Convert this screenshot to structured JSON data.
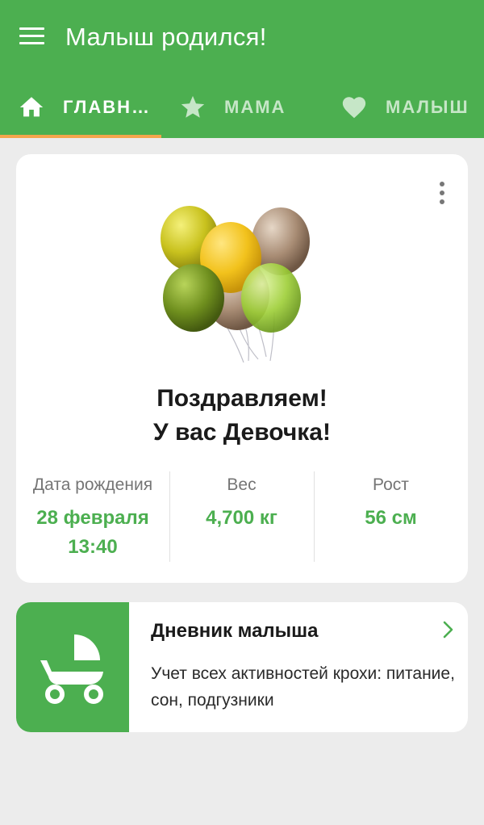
{
  "appbar": {
    "title": "Малыш родился!",
    "menu_icon": "hamburger-menu-icon",
    "color": "#4caf50"
  },
  "tabs": [
    {
      "label": "ГЛАВНАЯ",
      "icon": "home-icon",
      "active": true
    },
    {
      "label": "МАМА",
      "icon": "star-icon",
      "active": false
    },
    {
      "label": "МАЛЫШ",
      "icon": "heart-icon",
      "active": false
    }
  ],
  "tab_indicator_color": "#f4a54c",
  "main_card": {
    "more_icon": "more-vert-icon",
    "image": "balloons-illustration",
    "congrats_line1": "Поздравляем!",
    "congrats_line2": "У вас Девочка!",
    "stats": [
      {
        "label": "Дата рождения",
        "value": "28 февраля",
        "value2": "13:40"
      },
      {
        "label": "Вес",
        "value": "4,700 кг"
      },
      {
        "label": "Рост",
        "value": "56 см"
      }
    ]
  },
  "diary_card": {
    "icon": "stroller-icon",
    "title": "Дневник малыша",
    "description": "Учет всех активностей крохи: питание, сон, подгузники",
    "chevron_icon": "chevron-right-icon"
  }
}
